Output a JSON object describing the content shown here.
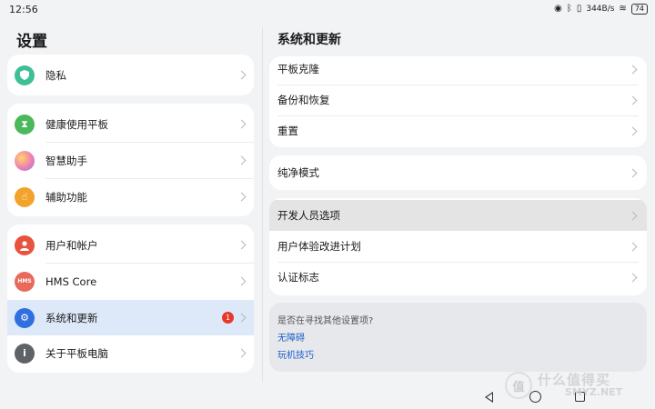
{
  "status": {
    "time": "12:56",
    "speed": "344B/s",
    "battery": "74"
  },
  "left": {
    "title": "设置",
    "groups": [
      {
        "items": [
          {
            "label": "隐私",
            "icon": "shield-icon",
            "color": "#3fbf96"
          }
        ]
      },
      {
        "items": [
          {
            "label": "健康使用平板",
            "icon": "hourglass-icon",
            "color": "#4cb85c"
          },
          {
            "label": "智慧助手",
            "icon": "assistant-icon",
            "color": "#b87fe6"
          },
          {
            "label": "辅助功能",
            "icon": "hand-icon",
            "color": "#f3a22a"
          }
        ]
      },
      {
        "items": [
          {
            "label": "用户和帐户",
            "icon": "user-icon",
            "color": "#e8533e"
          },
          {
            "label": "HMS Core",
            "icon": "hms-icon",
            "color": "#e86a5c",
            "icon_text": "HMS"
          },
          {
            "label": "系统和更新",
            "icon": "gear-icon",
            "color": "#2f6fe0",
            "badge": "1",
            "selected": true
          },
          {
            "label": "关于平板电脑",
            "icon": "info-icon",
            "color": "#5f6368",
            "icon_text": "i"
          }
        ]
      }
    ]
  },
  "right": {
    "title": "系统和更新",
    "groups": [
      {
        "items": [
          "平板克隆",
          "备份和恢复",
          "重置"
        ]
      },
      {
        "items": [
          "纯净模式"
        ]
      },
      {
        "items": [
          "开发人员选项",
          "用户体验改进计划",
          "认证标志"
        ]
      }
    ],
    "hint": {
      "question": "是否在寻找其他设置项?",
      "links": [
        "无障碍",
        "玩机技巧"
      ]
    }
  },
  "watermark": {
    "logo": "值",
    "text": "什么值得买",
    "sub": "SMYZ.NET"
  }
}
